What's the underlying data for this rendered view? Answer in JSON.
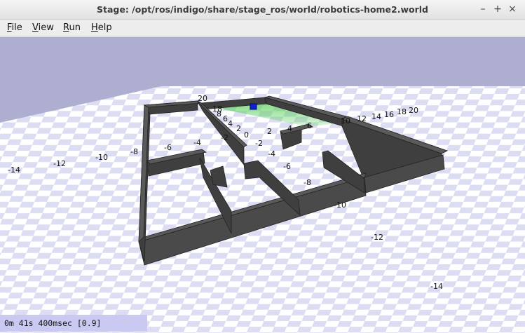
{
  "window": {
    "title": "Stage: /opt/ros/indigo/share/stage_ros/world/robotics-home2.world",
    "controls": {
      "minimize": "–",
      "maximize": "+",
      "close": "×"
    }
  },
  "menu": {
    "file": {
      "key": "F",
      "rest": "ile"
    },
    "view": {
      "key": "V",
      "rest": "iew"
    },
    "run": {
      "key": "R",
      "rest": "un"
    },
    "help": {
      "key": "H",
      "rest": "elp"
    }
  },
  "colors": {
    "sky": "#aeaed0",
    "floor_light": "#ffffff",
    "floor_dark": "#dcdcf2",
    "wall_top": "#5a5a5a",
    "wall_side": "#3f3f3f",
    "robot": "#1020d0",
    "laser": "#5cd05c"
  },
  "robot_icon": "robot-square",
  "status": {
    "text": "0m 41s 400msec [0.9]"
  },
  "ticks": [
    {
      "label": "20"
    },
    {
      "label": "18"
    },
    {
      "label": "8"
    },
    {
      "label": "6"
    },
    {
      "label": "4"
    },
    {
      "label": "2"
    },
    {
      "label": "0"
    },
    {
      "label": "2"
    },
    {
      "label": "4"
    },
    {
      "label": "6"
    },
    {
      "label": "10"
    },
    {
      "label": "12"
    },
    {
      "label": "14"
    },
    {
      "label": "16"
    },
    {
      "label": "18"
    },
    {
      "label": "20"
    },
    {
      "label": "-2"
    },
    {
      "label": "-2"
    },
    {
      "label": "-4"
    },
    {
      "label": "-4"
    },
    {
      "label": "-6"
    },
    {
      "label": "-6"
    },
    {
      "label": "-8"
    },
    {
      "label": "-8"
    },
    {
      "label": "-10"
    },
    {
      "label": "-10"
    },
    {
      "label": "-12"
    },
    {
      "label": "-12"
    },
    {
      "label": "-14"
    },
    {
      "label": "-14"
    }
  ]
}
